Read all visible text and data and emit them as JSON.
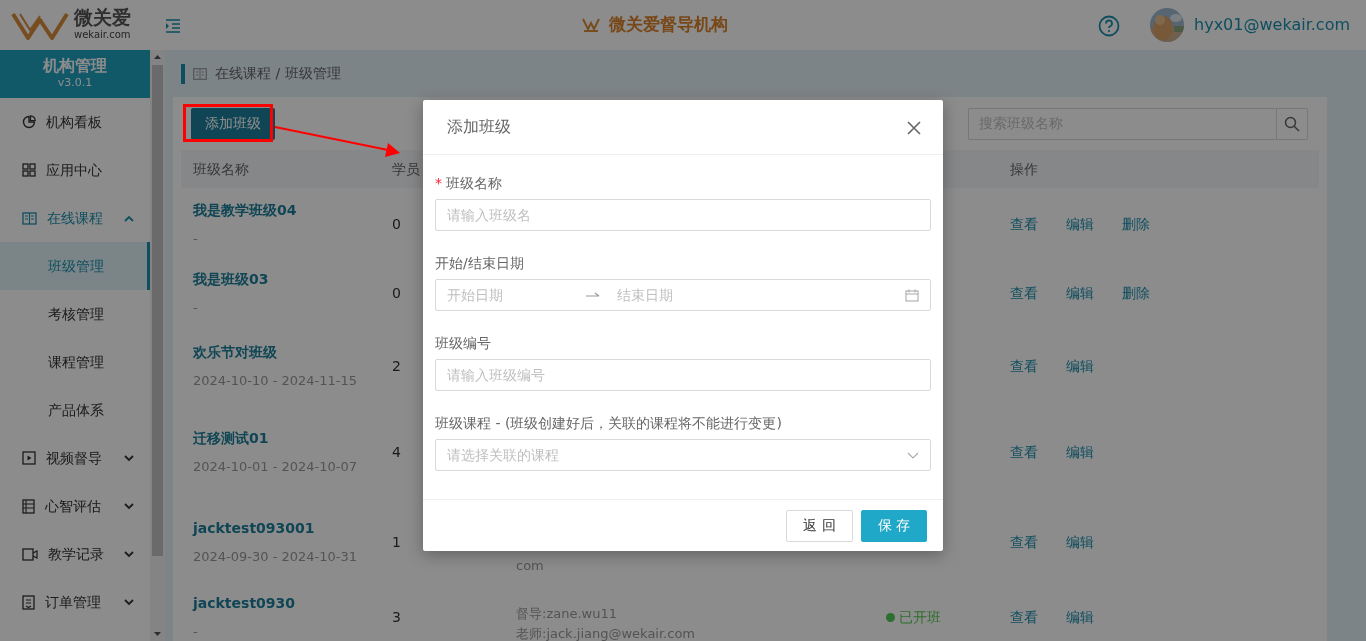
{
  "header": {
    "brand_name": "微关爱",
    "brand_domain": "wekair.com",
    "org_title": "微关爱督导机构",
    "user": "hyx01@wekair.com"
  },
  "sidebar": {
    "title": "机构管理",
    "version": "v3.0.1",
    "items": [
      {
        "label": "机构看板",
        "selected": false
      },
      {
        "label": "应用中心",
        "selected": false
      },
      {
        "label": "在线课程",
        "selected": false,
        "expanded": true,
        "children": [
          {
            "label": "班级管理",
            "selected": true
          },
          {
            "label": "考核管理",
            "selected": false
          },
          {
            "label": "课程管理",
            "selected": false
          },
          {
            "label": "产品体系",
            "selected": false
          }
        ]
      },
      {
        "label": "视频督导",
        "selected": false,
        "expanded": false
      },
      {
        "label": "心智评估",
        "selected": false,
        "expanded": false
      },
      {
        "label": "教学记录",
        "selected": false,
        "expanded": false
      },
      {
        "label": "订单管理",
        "selected": false,
        "expanded": false
      }
    ]
  },
  "breadcrumb": "在线课程 / 班级管理",
  "toolbar": {
    "add_button": "添加班级",
    "search": {
      "placeholder": "搜索班级名称"
    }
  },
  "table": {
    "columns": {
      "name": "班级名称",
      "students": "学员",
      "actions": "操作"
    },
    "rows": [
      {
        "name": "我是教学班级04",
        "dates": "-",
        "students": "0",
        "actions": [
          "查看",
          "编辑",
          "删除"
        ]
      },
      {
        "name": "我是班级03",
        "dates": "-",
        "students": "0",
        "actions": [
          "查看",
          "编辑",
          "删除"
        ]
      },
      {
        "name": "欢乐节对班级",
        "dates": "2024-10-10 - 2024-11-15",
        "students": "2",
        "actions": [
          "查看",
          "编辑"
        ]
      },
      {
        "name": "迁移测试01",
        "dates": "2024-10-01 - 2024-10-07",
        "students": "4",
        "actions": [
          "查看",
          "编辑"
        ]
      },
      {
        "name": "jacktest093001",
        "dates": "2024-09-30 - 2024-10-31",
        "students": "1",
        "staff": [
          "com"
        ],
        "actions": [
          "查看",
          "编辑"
        ]
      },
      {
        "name": "jacktest0930",
        "dates": "-",
        "students": "3",
        "staff": [
          "督导:zane.wu11",
          "老师:jack.jiang@wekair.com"
        ],
        "status": {
          "label": "已开班",
          "color": "#2e6e2e"
        },
        "actions": [
          "查看",
          "编辑"
        ]
      }
    ]
  },
  "modal": {
    "title": "添加班级",
    "fields": [
      {
        "kind": "text",
        "label": "班级名称",
        "required_mark": "*",
        "placeholder": "请输入班级名"
      },
      {
        "kind": "daterange",
        "label": "开始/结束日期",
        "start_placeholder": "开始日期",
        "end_placeholder": "结束日期"
      },
      {
        "kind": "text",
        "label": "班级编号",
        "placeholder": "请输入班级编号"
      },
      {
        "kind": "select",
        "label": "班级课程 - (班级创建好后，关联的课程将不能进行变更)",
        "placeholder": "请选择关联的课程"
      }
    ],
    "buttons": [
      {
        "kind": "default",
        "label": "返 回"
      },
      {
        "kind": "primary",
        "label": "保 存"
      }
    ]
  }
}
